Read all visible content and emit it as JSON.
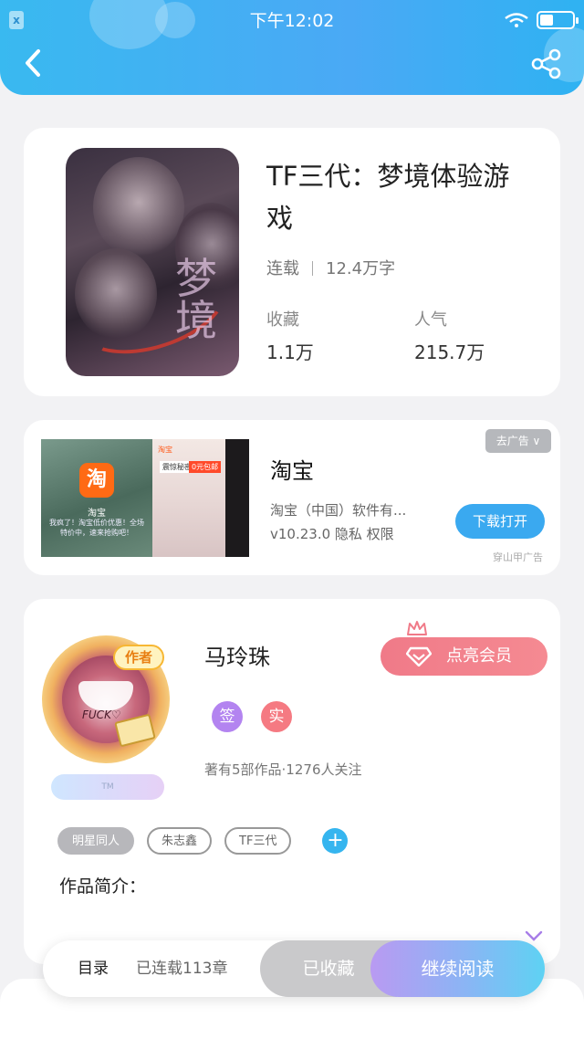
{
  "status_bar": {
    "time": "下午12:02",
    "notification_glyph": "x"
  },
  "header": {
    "back_icon": "chevron-left-icon",
    "share_icon": "share-icon"
  },
  "book": {
    "title": "TF三代：梦境体验游戏",
    "status": "连载",
    "word_count": "12.4万字",
    "collect_label": "收藏",
    "collect_value": "1.1万",
    "popularity_label": "人气",
    "popularity_value": "215.7万"
  },
  "ad": {
    "app_name": "淘宝",
    "description_line1": "淘宝（中国）软件有...",
    "description_line2": "v10.23.0  隐私  权限",
    "close_label": "去广告 ∨",
    "download_label": "下载打开",
    "source": "穿山甲广告",
    "image_logo_char": "淘",
    "image_name": "淘宝",
    "image_desc": "我疯了！淘宝低价优惠！全场特价中，速来抢购吧！",
    "image2_brand": "淘宝",
    "image2_tag1": "震惊秘密",
    "image2_tag2": "0元包邮"
  },
  "author": {
    "badge": "作者",
    "name": "马玲珠",
    "vip_label": "点亮会员",
    "badge_sign": "签",
    "badge_real": "实",
    "stats": "著有5部作品·1276人关注",
    "tags": [
      "明星同人",
      "朱志鑫",
      "TF三代"
    ],
    "intro_label": "作品简介：",
    "avatar_text": "FUCK♡",
    "ribbon_text": "TM"
  },
  "bottom_bar": {
    "toc_label": "目录",
    "serial_info": "已连载113章",
    "collected_label": "已收藏",
    "continue_label": "继续阅读"
  },
  "colors": {
    "header": "#39b9f0",
    "vip": "#f07a88",
    "sign_badge": "#b384f0",
    "real_badge": "#f57a82",
    "accent": "#35b5ef"
  }
}
